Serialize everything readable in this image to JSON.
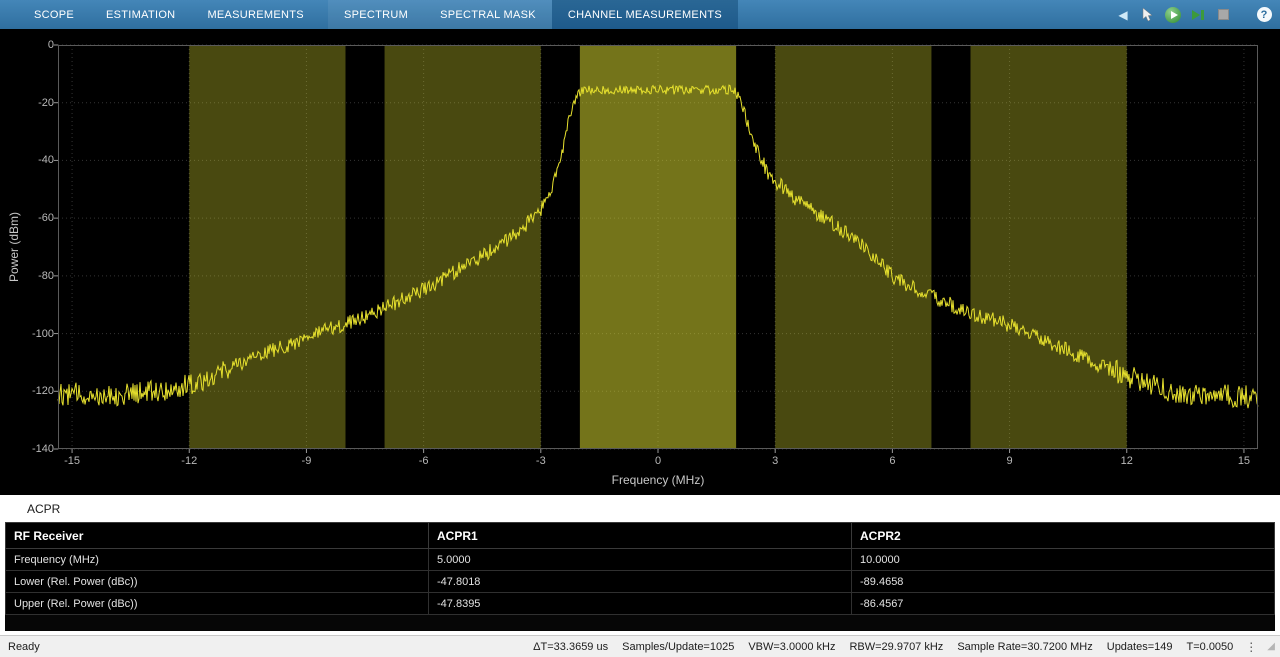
{
  "toolbar": {
    "tabs": [
      {
        "label": "SCOPE",
        "group": false
      },
      {
        "label": "ESTIMATION",
        "group": false
      },
      {
        "label": "MEASUREMENTS",
        "group": false
      },
      {
        "label": "SPECTRUM",
        "group": true
      },
      {
        "label": "SPECTRAL MASK",
        "group": true
      },
      {
        "label": "CHANNEL MEASUREMENTS",
        "group": true
      }
    ],
    "selected_tab": "CHANNEL MEASUREMENTS"
  },
  "icons": {
    "back": "◀",
    "help": "?",
    "kebab": "⋮",
    "grip": "◢"
  },
  "chart_data": {
    "type": "line",
    "title": "",
    "xlabel": "Frequency (MHz)",
    "ylabel": "Power (dBm)",
    "xlim": [
      -15.36,
      15.36
    ],
    "ylim": [
      -140,
      0
    ],
    "x_ticks": [
      -15,
      -12,
      -9,
      -6,
      -3,
      0,
      3,
      6,
      9,
      12,
      15
    ],
    "y_ticks": [
      0,
      -20,
      -40,
      -60,
      -80,
      -100,
      -120,
      -140
    ],
    "grid": true,
    "grid_color": "#343434",
    "trace_color": "#e6e02e",
    "legend": "none",
    "bands": [
      {
        "start_mhz": -12,
        "end_mhz": -8,
        "kind": "adjacent2",
        "color": "rgba(222,222,50,0.33)"
      },
      {
        "start_mhz": -7,
        "end_mhz": -3,
        "kind": "adjacent1",
        "color": "rgba(222,222,50,0.33)"
      },
      {
        "start_mhz": -2,
        "end_mhz": 2,
        "kind": "main",
        "color": "rgba(222,222,50,0.52)"
      },
      {
        "start_mhz": 3,
        "end_mhz": 7,
        "kind": "adjacent1",
        "color": "rgba(222,222,50,0.33)"
      },
      {
        "start_mhz": 8,
        "end_mhz": 12,
        "kind": "adjacent2",
        "color": "rgba(222,222,50,0.33)"
      }
    ],
    "envelope_points": [
      [
        -15.36,
        -121
      ],
      [
        -13.5,
        -121
      ],
      [
        -12.3,
        -119
      ],
      [
        -11.5,
        -115
      ],
      [
        -10.5,
        -109
      ],
      [
        -9.5,
        -104
      ],
      [
        -8.5,
        -99
      ],
      [
        -7.5,
        -94
      ],
      [
        -6.5,
        -88
      ],
      [
        -5.5,
        -81
      ],
      [
        -5,
        -77
      ],
      [
        -4.5,
        -73
      ],
      [
        -4,
        -69
      ],
      [
        -3.5,
        -64
      ],
      [
        -3,
        -57
      ],
      [
        -2.75,
        -50
      ],
      [
        -2.5,
        -40
      ],
      [
        -2.3,
        -28
      ],
      [
        -2.1,
        -18
      ],
      [
        -1.95,
        -15.5
      ],
      [
        1.95,
        -15.5
      ],
      [
        2.1,
        -19
      ],
      [
        2.3,
        -27
      ],
      [
        2.55,
        -37
      ],
      [
        2.8,
        -44
      ],
      [
        3,
        -47
      ],
      [
        3.5,
        -53
      ],
      [
        4,
        -58
      ],
      [
        4.5,
        -62
      ],
      [
        5,
        -67
      ],
      [
        5.5,
        -73
      ],
      [
        6,
        -80
      ],
      [
        6.5,
        -84
      ],
      [
        7,
        -87
      ],
      [
        7.5,
        -90
      ],
      [
        8,
        -93
      ],
      [
        8.5,
        -95
      ],
      [
        9,
        -97
      ],
      [
        9.5,
        -100
      ],
      [
        10,
        -103
      ],
      [
        10.5,
        -106
      ],
      [
        11,
        -109
      ],
      [
        11.5,
        -112
      ],
      [
        12,
        -114.5
      ],
      [
        12.6,
        -118
      ],
      [
        13.3,
        -120.5
      ],
      [
        14.2,
        -121.5
      ],
      [
        15.36,
        -122
      ]
    ],
    "noise_db": {
      "floor": 4.0,
      "slope": 2.6,
      "top": 1.6
    },
    "seed": 12
  },
  "acpr": {
    "title": "ACPR",
    "table": {
      "columns": [
        "RF Receiver",
        "ACPR1",
        "ACPR2"
      ],
      "rows": [
        [
          "Frequency (MHz)",
          "5.0000",
          "10.0000"
        ],
        [
          "Lower (Rel. Power (dBc))",
          "-47.8018",
          "-89.4658"
        ],
        [
          "Upper (Rel. Power (dBc))",
          "-47.8395",
          "-86.4567"
        ]
      ]
    }
  },
  "status_bar": {
    "ready": "Ready",
    "fields": [
      "ΔT=33.3659 us",
      "Samples/Update=1025",
      "VBW=3.0000 kHz",
      "RBW=29.9707 kHz",
      "Sample Rate=30.7200 MHz",
      "Updates=149",
      "T=0.0050"
    ]
  }
}
